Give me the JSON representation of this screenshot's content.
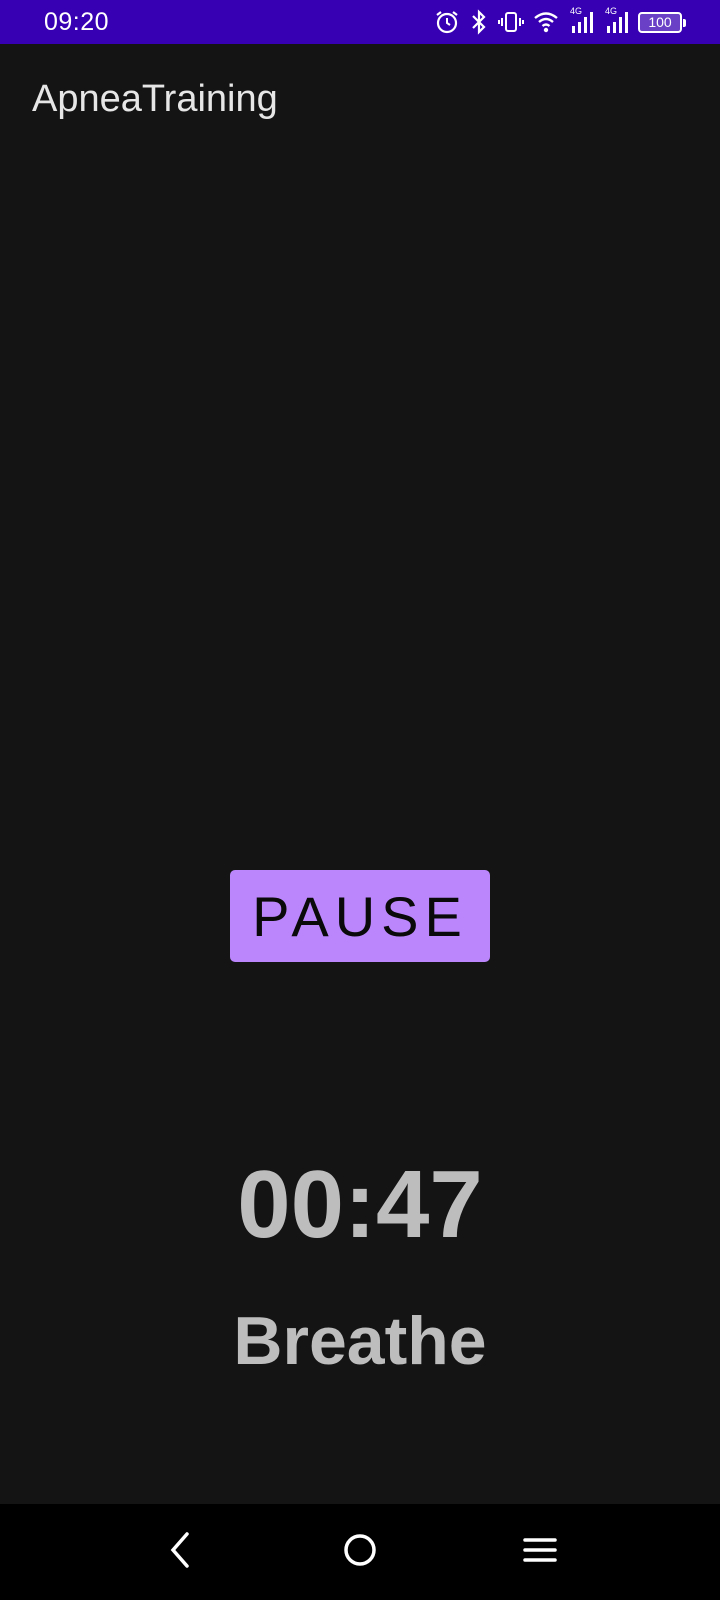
{
  "status_bar": {
    "time": "09:20",
    "battery": "100",
    "network_1": "4G",
    "network_2": "4G",
    "icons": [
      "alarm-icon",
      "bluetooth-icon",
      "vibrate-icon",
      "wifi-icon",
      "signal-icon",
      "signal-icon",
      "battery-icon"
    ]
  },
  "app": {
    "title": "ApneaTraining"
  },
  "controls": {
    "pause_label": "PAUSE"
  },
  "session": {
    "timer": "00:47",
    "phase": "Breathe"
  },
  "nav": {
    "icons": [
      "back-icon",
      "home-icon",
      "menu-icon"
    ]
  },
  "colors": {
    "status_bar": "#3700b3",
    "background": "#141414",
    "accent": "#bb86fc",
    "text_secondary": "#bdbdbd"
  }
}
